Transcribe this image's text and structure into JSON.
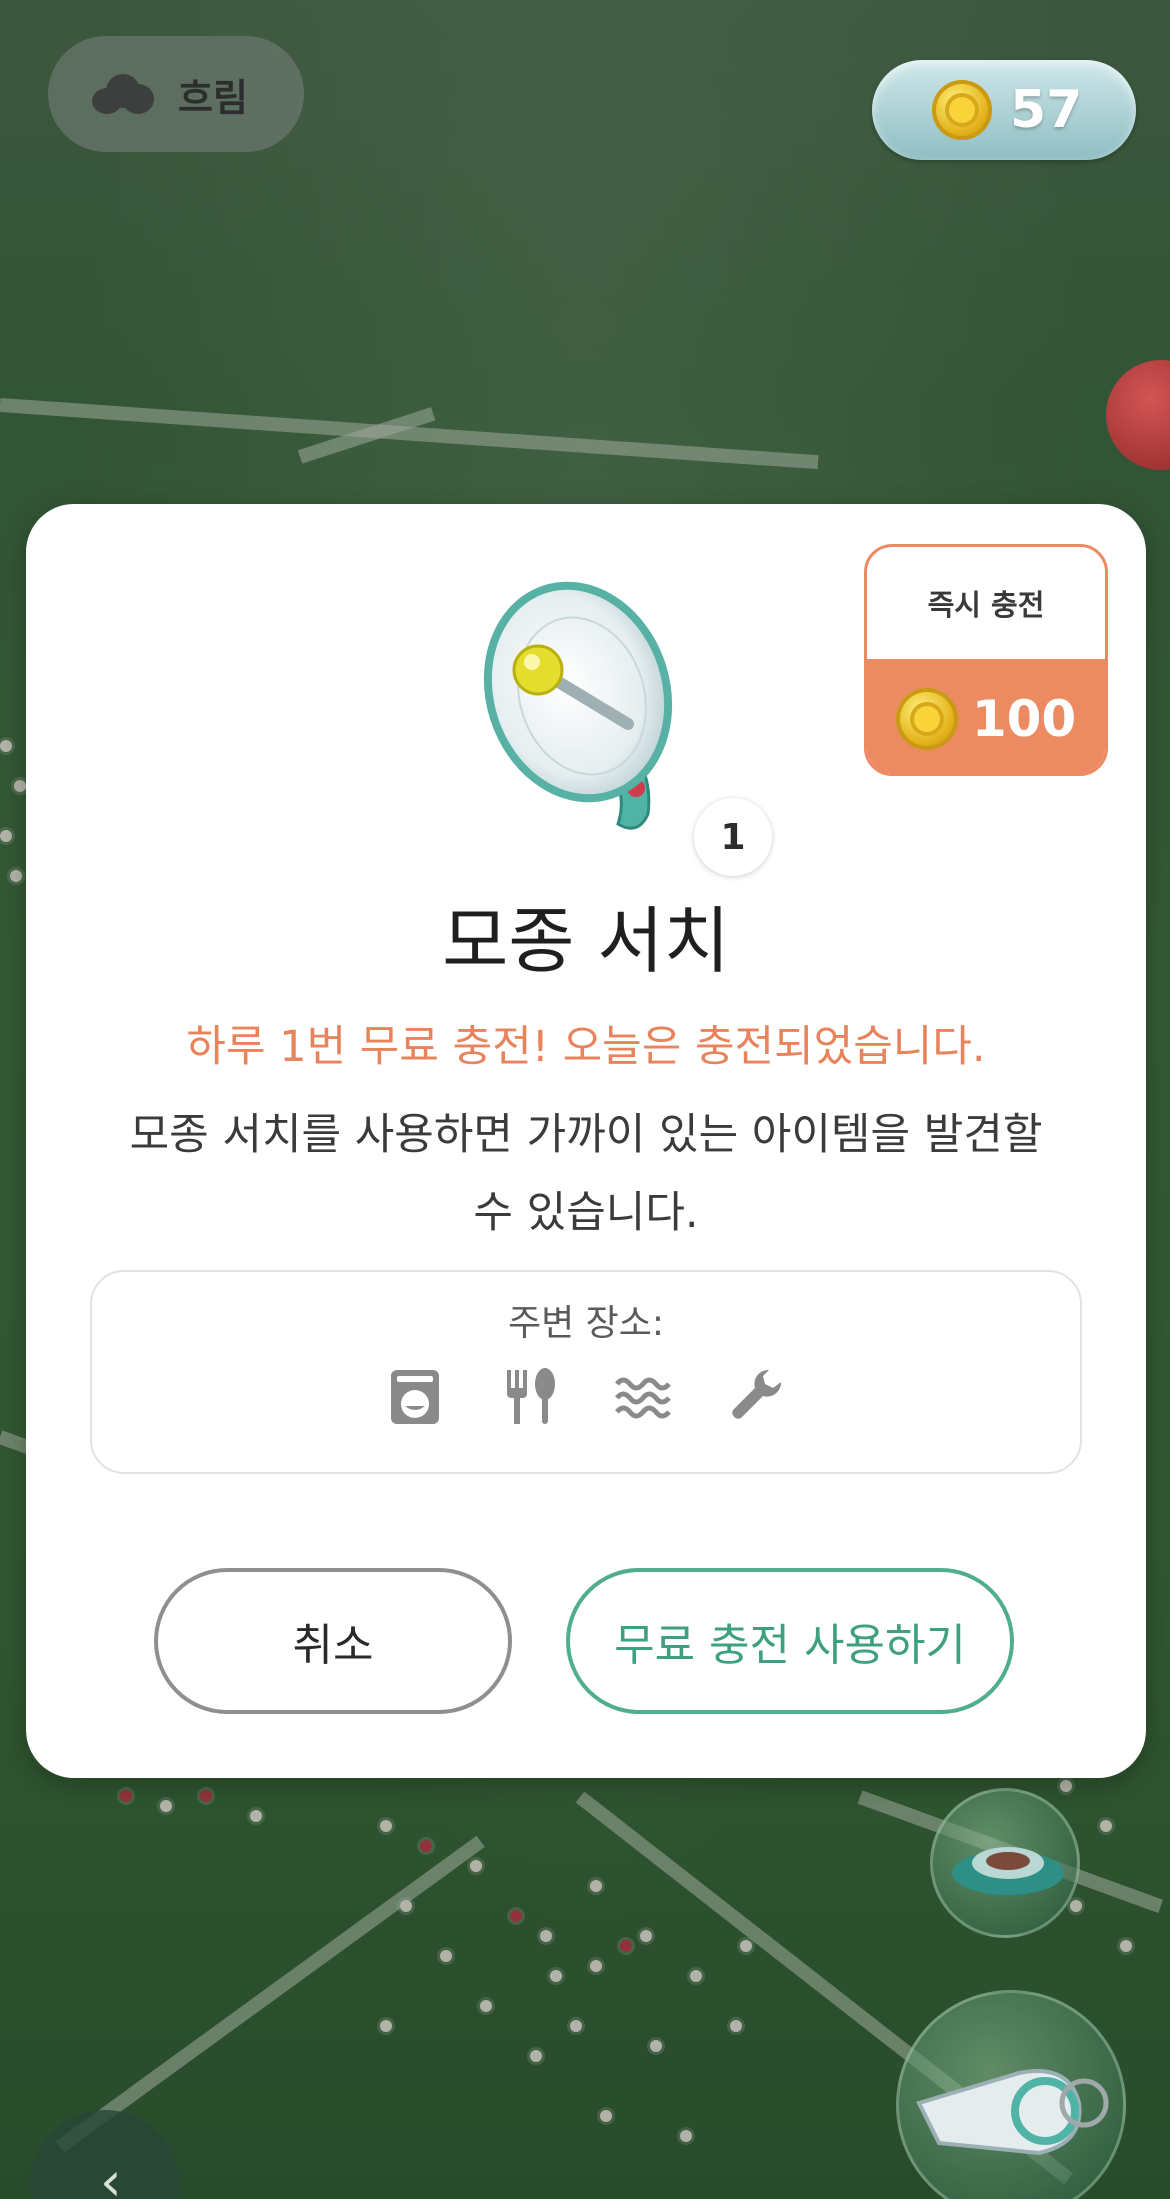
{
  "status_bar": {
    "weather_icon": "cloud-icon",
    "weather_label": "흐림",
    "coin_icon": "coin-icon",
    "coin_count": "57"
  },
  "modal": {
    "instant_charge": {
      "label": "즉시 충전",
      "price": "100",
      "color": "#ec8a62"
    },
    "item_icon": "megaphone-icon",
    "item_quantity": "1",
    "item_title": "모종 서치",
    "free_note": "하루 1번 무료 충전! 오늘은 충전되었습니다.",
    "description_line1": "모종 서치를 사용하면 가까이 있는 아이템을  발견할",
    "description_line2": "수 있습니다.",
    "places": {
      "label": "주변 장소:",
      "icons": [
        "laundry-icon",
        "restaurant-icon",
        "water-icon",
        "wrench-icon"
      ]
    },
    "cancel_label": "취소",
    "use_label": "무료 충전 사용하기",
    "accent_color": "#4fae8c"
  },
  "bottom_controls": {
    "back_icon": "chevron-left-icon",
    "side_buttons": [
      "plant-pot-icon",
      "whistle-icon"
    ]
  }
}
